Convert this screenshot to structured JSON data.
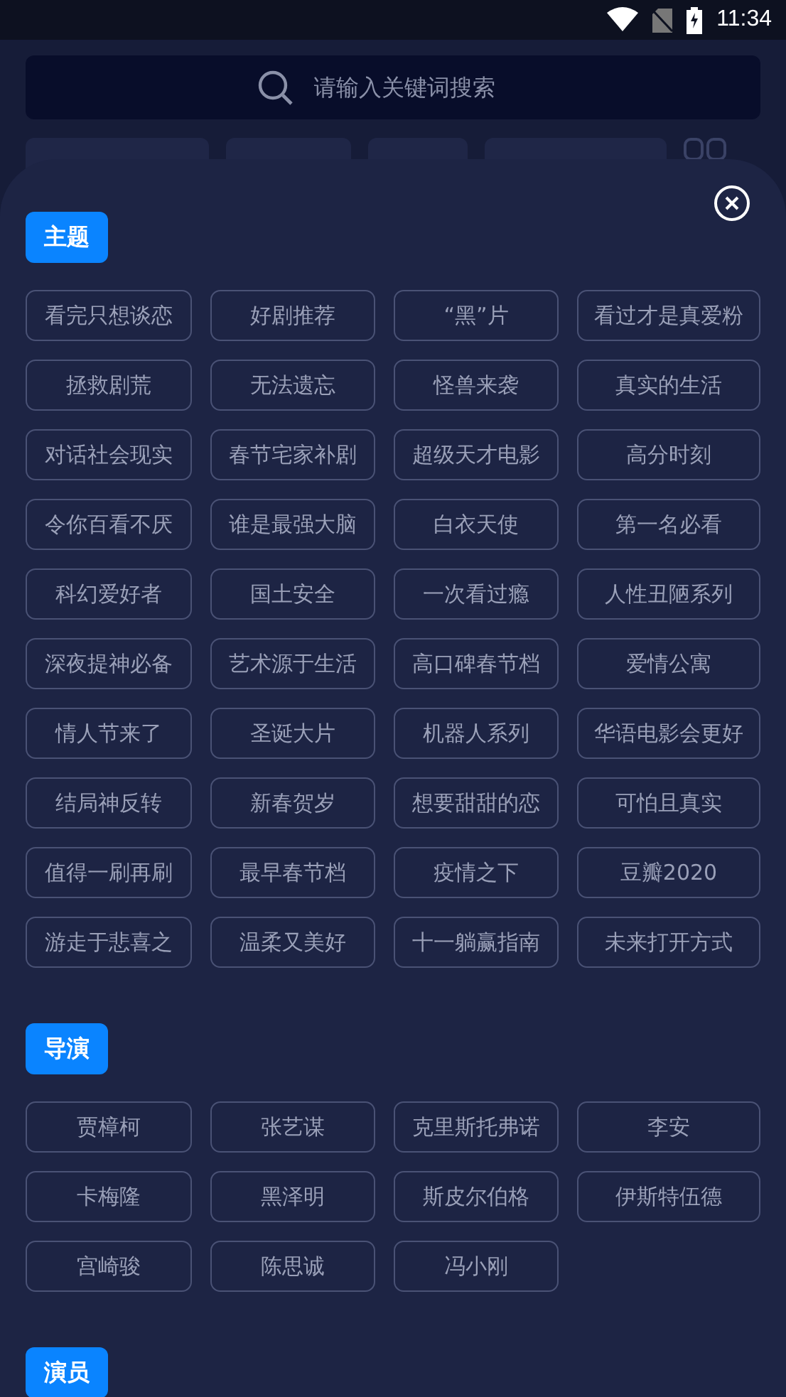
{
  "status_bar": {
    "time": "11:34"
  },
  "search": {
    "placeholder": "请输入关键词搜索"
  },
  "sections": [
    {
      "title": "主题",
      "tags": [
        "看完只想谈恋",
        "好剧推荐",
        "“黑”片",
        "看过才是真爱粉",
        "拯救剧荒",
        "无法遗忘",
        "怪兽来袭",
        "真实的生活",
        "对话社会现实",
        "春节宅家补剧",
        "超级天才电影",
        "高分时刻",
        "令你百看不厌",
        "谁是最强大脑",
        "白衣天使",
        "第一名必看",
        "科幻爱好者",
        "国土安全",
        "一次看过瘾",
        "人性丑陋系列",
        "深夜提神必备",
        "艺术源于生活",
        "高口碑春节档",
        "爱情公寓",
        "情人节来了",
        "圣诞大片",
        "机器人系列",
        "华语电影会更好",
        "结局神反转",
        "新春贺岁",
        "想要甜甜的恋",
        "可怕且真实",
        "值得一刷再刷",
        "最早春节档",
        "疫情之下",
        "豆瓣2020",
        "游走于悲喜之",
        "温柔又美好",
        "十一躺赢指南",
        "未来打开方式"
      ]
    },
    {
      "title": "导演",
      "tags": [
        "贾樟柯",
        "张艺谋",
        "克里斯托弗诺",
        "李安",
        "卡梅隆",
        "黑泽明",
        "斯皮尔伯格",
        "伊斯特伍德",
        "宫崎骏",
        "陈思诚",
        "冯小刚"
      ]
    },
    {
      "title": "演员"
    }
  ]
}
